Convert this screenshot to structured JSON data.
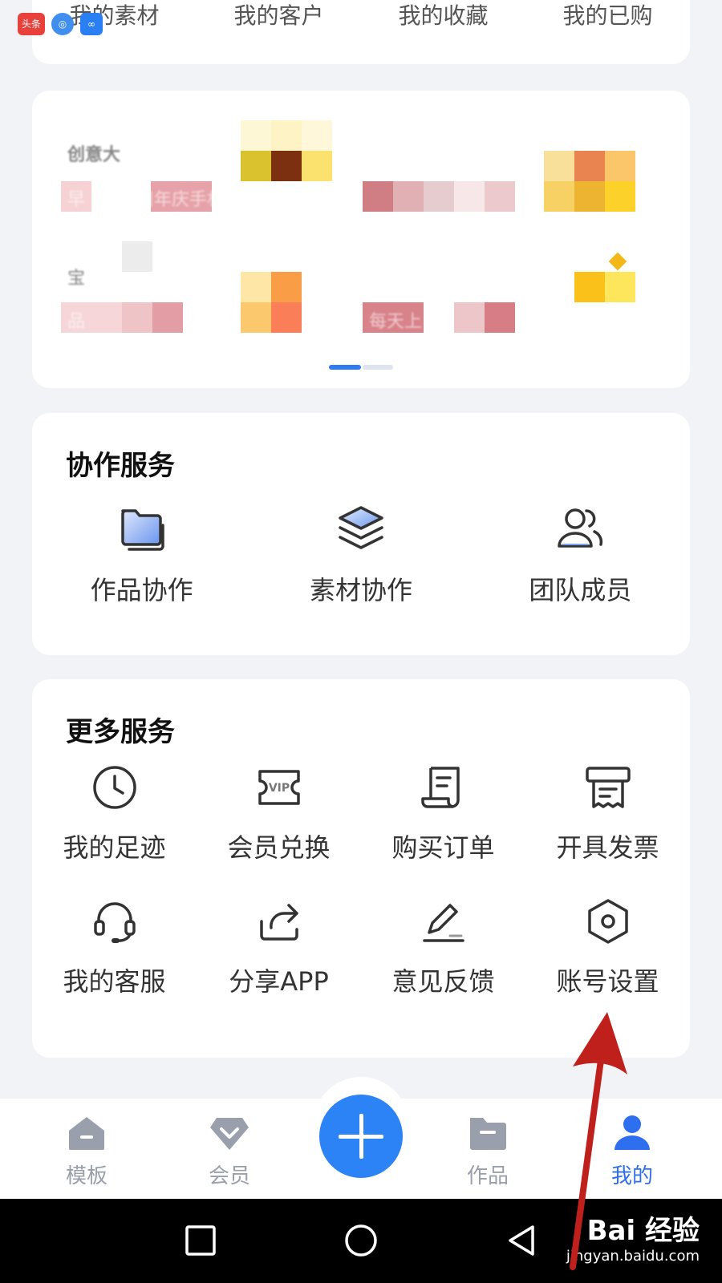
{
  "top_links": [
    "我的素材",
    "我的客户",
    "我的收藏",
    "我的已购"
  ],
  "status_icons": {
    "toutiao": "头条"
  },
  "banner": {
    "blur_text": [
      "创意大",
      "早",
      "周年庆手机",
      "宝",
      "品",
      "每天上"
    ]
  },
  "collab": {
    "title": "协作服务",
    "items": [
      {
        "label": "作品协作",
        "icon": "folder-icon"
      },
      {
        "label": "素材协作",
        "icon": "layers-icon"
      },
      {
        "label": "团队成员",
        "icon": "team-icon"
      }
    ]
  },
  "more": {
    "title": "更多服务",
    "items": [
      {
        "label": "我的足迹",
        "icon": "clock-icon"
      },
      {
        "label": "会员兑换",
        "icon": "vip-ticket-icon"
      },
      {
        "label": "购买订单",
        "icon": "receipt-icon"
      },
      {
        "label": "开具发票",
        "icon": "invoice-icon"
      },
      {
        "label": "我的客服",
        "icon": "headset-icon"
      },
      {
        "label": "分享APP",
        "icon": "share-icon"
      },
      {
        "label": "意见反馈",
        "icon": "pen-icon"
      },
      {
        "label": "账号设置",
        "icon": "settings-hex-icon"
      }
    ]
  },
  "bottom_nav": {
    "items": [
      {
        "label": "模板",
        "icon": "home-icon"
      },
      {
        "label": "会员",
        "icon": "diamond-icon"
      },
      {
        "label": "作品",
        "icon": "folder-icon"
      },
      {
        "label": "我的",
        "icon": "person-icon",
        "active": true
      }
    ],
    "fab_icon": "plus-icon"
  },
  "watermark": {
    "main": "Bai 经验",
    "sub": "jingyan.baidu.com"
  },
  "colors": {
    "accent": "#2e6ff0",
    "fab": "#2b83f6",
    "arrow": "#c0201c"
  }
}
